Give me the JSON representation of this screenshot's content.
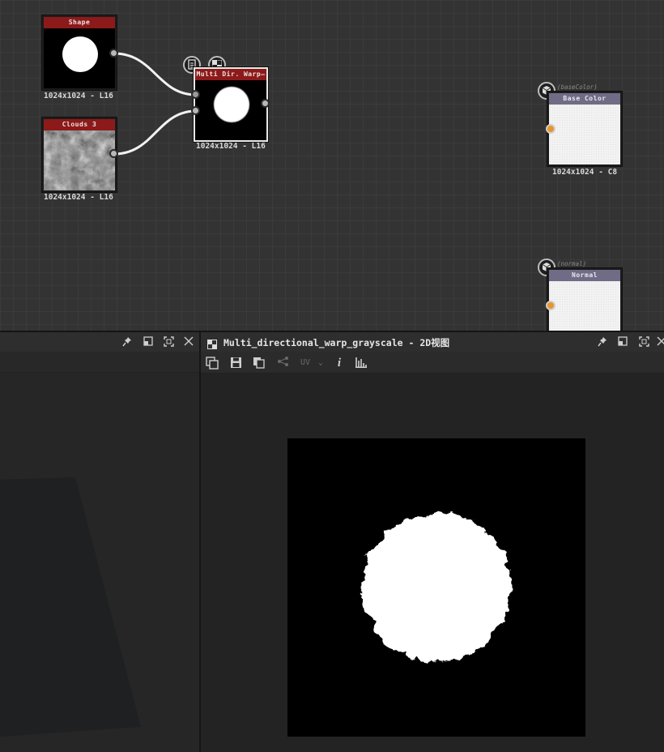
{
  "graph": {
    "nodes": {
      "shape": {
        "title": "Shape",
        "size": "1024x1024 - L16"
      },
      "clouds": {
        "title": "Clouds 3",
        "size": "1024x1024 - L16"
      },
      "warp": {
        "title": "Multi Dir. Warp—",
        "size": "1024x1024 - L16"
      },
      "basecolor": {
        "title": "Base Color",
        "size": "1024x1024 - C8",
        "tag": "(baseColor)"
      },
      "normal": {
        "title": "Normal",
        "tag": "(normal)"
      }
    }
  },
  "panel2d": {
    "title": "Multi_directional_warp_grayscale - 2D视图",
    "toolbar": {
      "uv_label": "UV",
      "info_label": "i"
    }
  },
  "icons": {
    "pin": "pin-icon",
    "float": "float-window-icon",
    "maximize": "maximize-icon",
    "close": "close-icon",
    "panel": "checker-panel-icon",
    "copy-view": "copy-view-icon",
    "save": "save-icon",
    "copy": "copy-icon",
    "share": "share-icon",
    "histogram": "histogram-icon"
  },
  "colors": {
    "node_header": "#8c1a1a",
    "output_header": "#706c86",
    "output_port": "#e8952a",
    "selection": "#e8e8e8"
  }
}
